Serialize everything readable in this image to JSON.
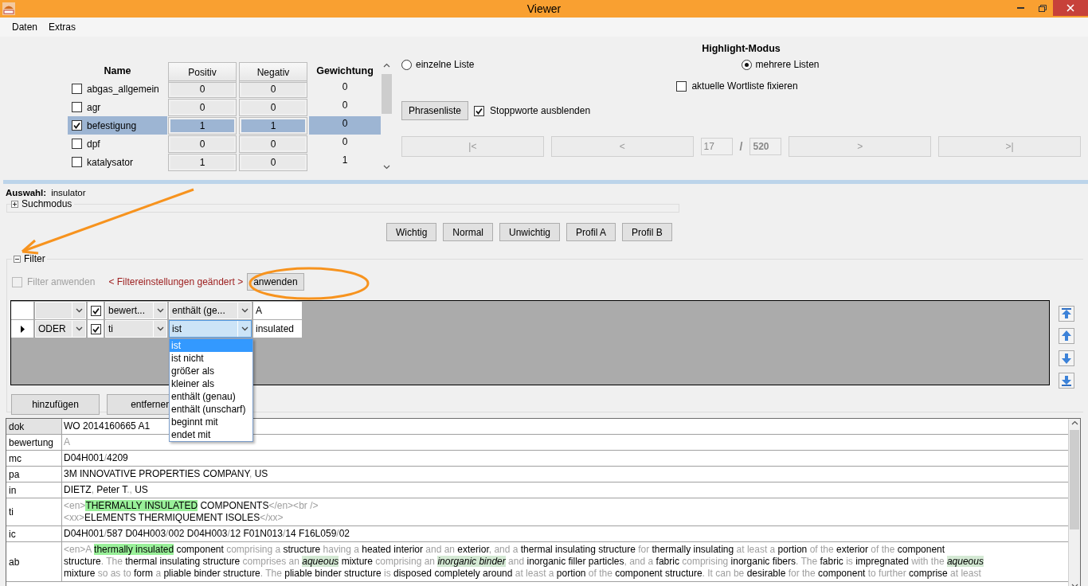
{
  "window": {
    "title": "Viewer"
  },
  "menu": [
    "Daten",
    "Extras"
  ],
  "word_lists": {
    "columns": [
      "Name",
      "Positiv",
      "Negativ",
      "Gewichtung"
    ],
    "rows": [
      {
        "name": "abgas_allgemein",
        "checked": false,
        "selected": false,
        "positiv": "0",
        "negativ": "0",
        "gewichtung": "0"
      },
      {
        "name": "agr",
        "checked": false,
        "selected": false,
        "positiv": "0",
        "negativ": "0",
        "gewichtung": "0"
      },
      {
        "name": "befestigung",
        "checked": true,
        "selected": true,
        "positiv": "1",
        "negativ": "1",
        "gewichtung": "0"
      },
      {
        "name": "dpf",
        "checked": false,
        "selected": false,
        "positiv": "0",
        "negativ": "0",
        "gewichtung": "0"
      },
      {
        "name": "katalysator",
        "checked": false,
        "selected": false,
        "positiv": "1",
        "negativ": "0",
        "gewichtung": "1"
      }
    ]
  },
  "highlight": {
    "title": "Highlight-Modus",
    "modes": [
      {
        "label": "einzelne Liste",
        "selected": false
      },
      {
        "label": "mehrere Listen",
        "selected": true
      }
    ],
    "fix_wordlist": {
      "label": "aktuelle Wortliste fixieren",
      "checked": false
    },
    "phrase_button": "Phrasenliste",
    "stopwords": {
      "label": "Stoppworte ausblenden",
      "checked": true
    }
  },
  "navigation": {
    "disabled": true,
    "first": "|<",
    "prev": "<",
    "current": "17",
    "separator": "/",
    "total": "520",
    "next": ">",
    "last": ">|"
  },
  "selection": {
    "label": "Auswahl:",
    "value": "insulator"
  },
  "search_mode": {
    "label": "Suchmodus",
    "expanded": false
  },
  "profile_buttons": [
    "Wichtig",
    "Normal",
    "Unwichtig",
    "Profil A",
    "Profil B"
  ],
  "filter": {
    "label": "Filter",
    "expanded": true,
    "apply": {
      "label": "Filter anwenden",
      "checked": false,
      "disabled": true
    },
    "notice": "< Filtereinstellungen geändert >",
    "apply_button": "anwenden",
    "rows": [
      {
        "current": false,
        "enabled": true,
        "field": "bewert...",
        "operator": "enthält (ge...",
        "operator_open": false,
        "value": "A"
      },
      {
        "current": true,
        "conjunction": "ODER",
        "enabled": true,
        "field": "ti",
        "operator": "ist",
        "operator_open": true,
        "value": "insulated"
      }
    ],
    "operator_options": [
      {
        "label": "ist",
        "selected": true
      },
      {
        "label": "ist nicht",
        "selected": false
      },
      {
        "label": "größer als",
        "selected": false
      },
      {
        "label": "kleiner als",
        "selected": false
      },
      {
        "label": "enthält (genau)",
        "selected": false
      },
      {
        "label": "enthält (unscharf)",
        "selected": false
      },
      {
        "label": "beginnt mit",
        "selected": false
      },
      {
        "label": "endet mit",
        "selected": false
      }
    ],
    "add_button": "hinzufügen",
    "remove_button": "entfernen"
  },
  "document": {
    "fields": [
      {
        "name": "dok",
        "selected": true,
        "lines": [
          [
            {
              "t": "WO 2014160665 A1"
            }
          ]
        ]
      },
      {
        "name": "bewertung",
        "selected": false,
        "lines": [
          [
            {
              "t": "A",
              "stop": true
            }
          ]
        ]
      },
      {
        "name": "mc",
        "selected": false,
        "lines": [
          [
            {
              "t": "D04H001"
            },
            {
              "t": "/",
              "stop": true
            },
            {
              "t": "4209"
            }
          ]
        ]
      },
      {
        "name": "pa",
        "selected": false,
        "lines": [
          [
            {
              "t": "3M INNOVATIVE PROPERTIES COMPANY"
            },
            {
              "t": ",",
              "stop": true
            },
            {
              "t": " US"
            }
          ]
        ]
      },
      {
        "name": "in",
        "selected": false,
        "lines": [
          [
            {
              "t": "DIETZ"
            },
            {
              "t": ",",
              "stop": true
            },
            {
              "t": " Peter T"
            },
            {
              "t": ".,",
              "stop": true
            },
            {
              "t": " US"
            }
          ]
        ]
      },
      {
        "name": "ti",
        "selected": false,
        "lines": [
          [
            {
              "t": "<en>",
              "stop": true
            },
            {
              "t": "THERMALLY INSULATED",
              "hit": true
            },
            {
              "t": " COMPONENTS"
            },
            {
              "t": "</en><br />",
              "stop": true
            }
          ],
          [
            {
              "t": "<xx>",
              "stop": true
            },
            {
              "t": "ELEMENTS THERMIQUEMENT ISOLES"
            },
            {
              "t": "</xx>",
              "stop": true
            }
          ]
        ]
      },
      {
        "name": "ic",
        "selected": false,
        "lines": [
          [
            {
              "t": "D04H001"
            },
            {
              "t": "/",
              "stop": true
            },
            {
              "t": "587 D04H003"
            },
            {
              "t": "/",
              "stop": true
            },
            {
              "t": "002 D04H003"
            },
            {
              "t": "/",
              "stop": true
            },
            {
              "t": "12 F01N013"
            },
            {
              "t": "/",
              "stop": true
            },
            {
              "t": "14 F16L059"
            },
            {
              "t": "/",
              "stop": true
            },
            {
              "t": "02"
            }
          ]
        ]
      },
      {
        "name": "ab",
        "selected": false,
        "lines": [
          [
            {
              "t": "<en>A ",
              "stop": true
            },
            {
              "t": "thermally insulated",
              "hit": true
            },
            {
              "t": " component"
            },
            {
              "t": " comprising a",
              "stop": true
            },
            {
              "t": " structure"
            },
            {
              "t": " having a",
              "stop": true
            },
            {
              "t": " heated interior"
            },
            {
              "t": " and an",
              "stop": true
            },
            {
              "t": " exterior"
            },
            {
              "t": ", and a",
              "stop": true
            },
            {
              "t": " thermal insulating structure"
            },
            {
              "t": " for",
              "stop": true
            },
            {
              "t": " thermally insulating"
            },
            {
              "t": " at least a",
              "stop": true
            },
            {
              "t": " portion"
            },
            {
              "t": " of the",
              "stop": true
            },
            {
              "t": " exterior"
            },
            {
              "t": " of the",
              "stop": true
            },
            {
              "t": " component"
            }
          ],
          [
            {
              "t": "structure"
            },
            {
              "t": ". The",
              "stop": true
            },
            {
              "t": " thermal insulating structure"
            },
            {
              "t": " comprises an ",
              "stop": true
            },
            {
              "t": "aqueous",
              "soft": true
            },
            {
              "t": " mixture"
            },
            {
              "t": " comprising an ",
              "stop": true
            },
            {
              "t": "inorganic binder",
              "soft": true
            },
            {
              "t": " and",
              "stop": true
            },
            {
              "t": " inorganic filler particles"
            },
            {
              "t": ", and a",
              "stop": true
            },
            {
              "t": " fabric"
            },
            {
              "t": " comprising",
              "stop": true
            },
            {
              "t": " inorganic fibers"
            },
            {
              "t": ". The",
              "stop": true
            },
            {
              "t": " fabric"
            },
            {
              "t": " is",
              "stop": true
            },
            {
              "t": " impregnated"
            },
            {
              "t": " with the ",
              "stop": true
            },
            {
              "t": "aqueous",
              "soft": true
            }
          ],
          [
            {
              "t": "mixture"
            },
            {
              "t": " so as to",
              "stop": true
            },
            {
              "t": " form"
            },
            {
              "t": " a",
              "stop": true
            },
            {
              "t": " pliable binder structure"
            },
            {
              "t": ". The",
              "stop": true
            },
            {
              "t": " pliable binder structure"
            },
            {
              "t": " is",
              "stop": true
            },
            {
              "t": " disposed completely around"
            },
            {
              "t": " at least a",
              "stop": true
            },
            {
              "t": " portion"
            },
            {
              "t": " of the",
              "stop": true
            },
            {
              "t": " component structure"
            },
            {
              "t": ". It can be",
              "stop": true
            },
            {
              "t": " desirable"
            },
            {
              "t": " for the",
              "stop": true
            },
            {
              "t": " component"
            },
            {
              "t": " to further",
              "stop": true
            },
            {
              "t": " comprise"
            },
            {
              "t": " at least",
              "stop": true
            }
          ]
        ]
      }
    ]
  }
}
